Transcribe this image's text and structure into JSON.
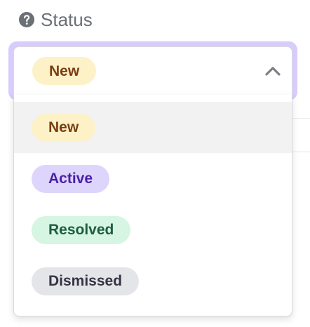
{
  "field": {
    "label": "Status",
    "help_icon": "question-circle-icon",
    "label_color": "#6b6f76"
  },
  "select": {
    "selected_value": "New",
    "caret_icon": "chevron-up-icon",
    "focus_ring_color": "#d7ccfb",
    "expanded": true
  },
  "options": [
    {
      "label": "New",
      "hovered": true,
      "bg": "#fdf1c8",
      "fg": "#7a3e12"
    },
    {
      "label": "Active",
      "hovered": false,
      "bg": "#ddd5fb",
      "fg": "#4b1fa8"
    },
    {
      "label": "Resolved",
      "hovered": false,
      "bg": "#d6f5e3",
      "fg": "#1d5e3c"
    },
    {
      "label": "Dismissed",
      "hovered": false,
      "bg": "#e4e5e9",
      "fg": "#303642"
    }
  ]
}
